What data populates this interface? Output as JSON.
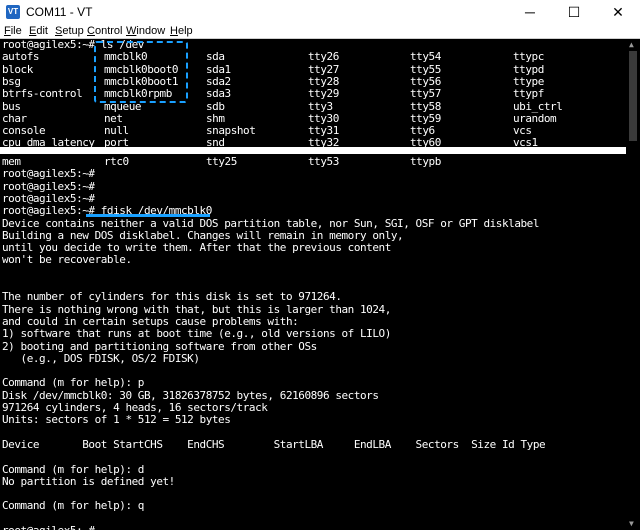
{
  "window": {
    "title": "COM11 - VT",
    "icon_label": "VT",
    "controls": {
      "minimize": "─",
      "maximize": "☐",
      "close": "✕"
    }
  },
  "menu": [
    {
      "label": "File",
      "hotkey": "F",
      "rest": "ile"
    },
    {
      "label": "Edit",
      "hotkey": "E",
      "rest": "dit"
    },
    {
      "label": "Setup",
      "hotkey": "S",
      "rest": "etup"
    },
    {
      "label": "Control",
      "hotkey": "C",
      "rest": "ontrol"
    },
    {
      "label": "Window",
      "hotkey": "W",
      "rest": "indow"
    },
    {
      "label": "Help",
      "hotkey": "H",
      "rest": "elp"
    }
  ],
  "top_pane": {
    "prompt": "root@agilex5:~# ls /dev",
    "rows": [
      [
        "autofs",
        "mmcblk0",
        "sda",
        "tty26",
        "tty54",
        "ttypc"
      ],
      [
        "block",
        "mmcblk0boot0",
        "sda1",
        "tty27",
        "tty55",
        "ttypd"
      ],
      [
        "bsg",
        "mmcblk0boot1",
        "sda2",
        "tty28",
        "tty56",
        "ttype"
      ],
      [
        "btrfs-control",
        "mmcblk0rpmb",
        "sda3",
        "tty29",
        "tty57",
        "ttypf"
      ],
      [
        "bus",
        "mqueue",
        "sdb",
        "tty3",
        "tty58",
        "ubi_ctrl"
      ],
      [
        "char",
        "net",
        "shm",
        "tty30",
        "tty59",
        "urandom"
      ],
      [
        "console",
        "null",
        "snapshot",
        "tty31",
        "tty6",
        "vcs"
      ],
      [
        "cpu_dma_latency",
        "port",
        "snd",
        "tty32",
        "tty60",
        "vcs1"
      ]
    ]
  },
  "bottom_pane": {
    "rows": [
      [
        "mem",
        "rtc0",
        "tty25",
        "tty53",
        "ttypb",
        ""
      ]
    ],
    "lines": [
      "root@agilex5:~#",
      "root@agilex5:~#",
      "root@agilex5:~#",
      "root@agilex5:~# fdisk /dev/mmcblk0",
      "Device contains neither a valid DOS partition table, nor Sun, SGI, OSF or GPT disklabel",
      "Building a new DOS disklabel. Changes will remain in memory only,",
      "until you decide to write them. After that the previous content",
      "won't be recoverable.",
      "",
      "",
      "The number of cylinders for this disk is set to 971264.",
      "There is nothing wrong with that, but this is larger than 1024,",
      "and could in certain setups cause problems with:",
      "1) software that runs at boot time (e.g., old versions of LILO)",
      "2) booting and partitioning software from other OSs",
      "   (e.g., DOS FDISK, OS/2 FDISK)",
      "",
      "Command (m for help): p",
      "Disk /dev/mmcblk0: 30 GB, 31826378752 bytes, 62160896 sectors",
      "971264 cylinders, 4 heads, 16 sectors/track",
      "Units: sectors of 1 * 512 = 512 bytes",
      "",
      "Device       Boot StartCHS    EndCHS        StartLBA     EndLBA    Sectors  Size Id Type",
      "",
      "Command (m for help): d",
      "No partition is defined yet!",
      "",
      "Command (m for help): q",
      "",
      "root@agilex5:~#"
    ]
  },
  "annotation_color": "#19a0ff"
}
